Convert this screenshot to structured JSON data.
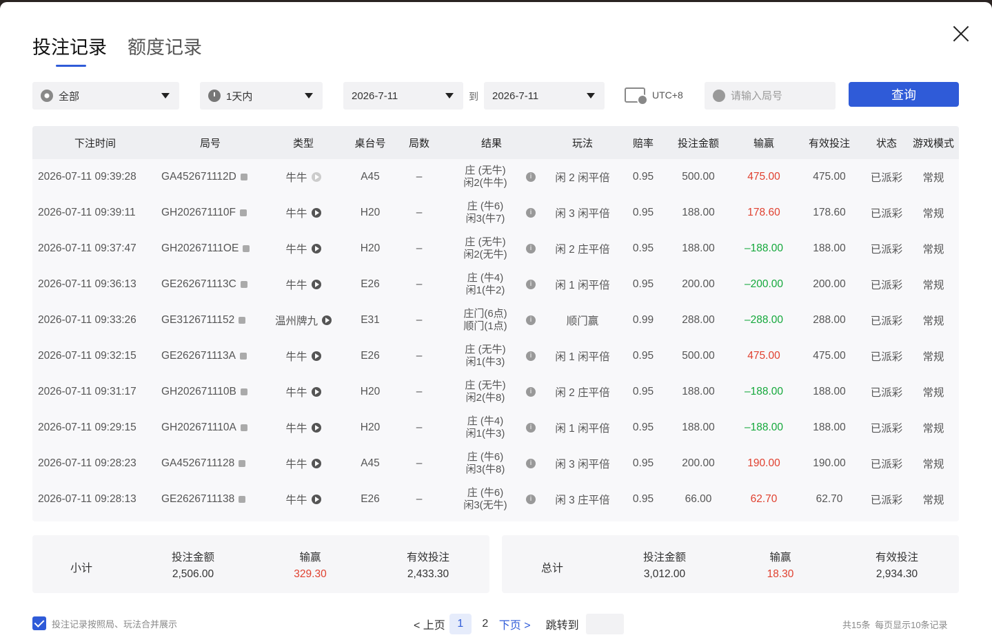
{
  "tabs": [
    {
      "label": "投注记录",
      "active": true
    },
    {
      "label": "额度记录",
      "active": false
    }
  ],
  "filters": {
    "game_type": "全部",
    "period": "1天内",
    "date_from": "2026-7-11",
    "to_label": "到",
    "date_to": "2026-7-11",
    "timezone": "UTC+8",
    "search_placeholder": "请输入局号",
    "query_button": "查询"
  },
  "table": {
    "headers": [
      "下注时间",
      "局号",
      "类型",
      "桌台号",
      "局数",
      "结果",
      "玩法",
      "赔率",
      "投注金额",
      "输赢",
      "有效投注",
      "状态",
      "游戏模式"
    ],
    "rows": [
      {
        "time": "2026-07-11 09:39:28",
        "id": "GA452671112D",
        "type": "牛牛",
        "table": "A45",
        "round": "–",
        "result1": "庄 (无牛)",
        "result2": "闲2(牛牛)",
        "play": "闲 2 闲平倍",
        "odds": "0.95",
        "bet": "500.00",
        "win": "475.00",
        "valid": "475.00",
        "status": "已派彩",
        "mode": "常规"
      },
      {
        "time": "2026-07-11 09:39:11",
        "id": "GH202671110F",
        "type": "牛牛",
        "table": "H20",
        "round": "–",
        "result1": "庄 (牛6)",
        "result2": "闲3(牛7)",
        "play": "闲 3 闲平倍",
        "odds": "0.95",
        "bet": "188.00",
        "win": "178.60",
        "valid": "178.60",
        "status": "已派彩",
        "mode": "常规"
      },
      {
        "time": "2026-07-11 09:37:47",
        "id": "GH20267111OE",
        "type": "牛牛",
        "table": "H20",
        "round": "–",
        "result1": "庄 (无牛)",
        "result2": "闲2(无牛)",
        "play": "闲 2 庄平倍",
        "odds": "0.95",
        "bet": "188.00",
        "win": "–188.00",
        "valid": "188.00",
        "status": "已派彩",
        "mode": "常规"
      },
      {
        "time": "2026-07-11 09:36:13",
        "id": "GE262671113C",
        "type": "牛牛",
        "table": "E26",
        "round": "–",
        "result1": "庄 (牛4)",
        "result2": "闲1(牛2)",
        "play": "闲 1 闲平倍",
        "odds": "0.95",
        "bet": "200.00",
        "win": "–200.00",
        "valid": "200.00",
        "status": "已派彩",
        "mode": "常规"
      },
      {
        "time": "2026-07-11 09:33:26",
        "id": "GE3126711152",
        "type": "温州牌九",
        "table": "E31",
        "round": "–",
        "result1": "庄门(6点)",
        "result2": "顺门(1点)",
        "play": "顺门赢",
        "odds": "0.99",
        "bet": "288.00",
        "win": "–288.00",
        "valid": "288.00",
        "status": "已派彩",
        "mode": "常规"
      },
      {
        "time": "2026-07-11 09:32:15",
        "id": "GE262671113A",
        "type": "牛牛",
        "table": "E26",
        "round": "–",
        "result1": "庄 (无牛)",
        "result2": "闲1(牛3)",
        "play": "闲 1 闲平倍",
        "odds": "0.95",
        "bet": "500.00",
        "win": "475.00",
        "valid": "475.00",
        "status": "已派彩",
        "mode": "常规"
      },
      {
        "time": "2026-07-11 09:31:17",
        "id": "GH202671110B",
        "type": "牛牛",
        "table": "H20",
        "round": "–",
        "result1": "庄 (无牛)",
        "result2": "闲2(牛8)",
        "play": "闲 2 庄平倍",
        "odds": "0.95",
        "bet": "188.00",
        "win": "–188.00",
        "valid": "188.00",
        "status": "已派彩",
        "mode": "常规"
      },
      {
        "time": "2026-07-11 09:29:15",
        "id": "GH202671110A",
        "type": "牛牛",
        "table": "H20",
        "round": "–",
        "result1": "庄 (牛4)",
        "result2": "闲1(牛3)",
        "play": "闲 1 闲平倍",
        "odds": "0.95",
        "bet": "188.00",
        "win": "–188.00",
        "valid": "188.00",
        "status": "已派彩",
        "mode": "常规"
      },
      {
        "time": "2026-07-11 09:28:23",
        "id": "GA4526711128",
        "type": "牛牛",
        "table": "A45",
        "round": "–",
        "result1": "庄 (牛6)",
        "result2": "闲3(牛8)",
        "play": "闲 3 闲平倍",
        "odds": "0.95",
        "bet": "200.00",
        "win": "190.00",
        "valid": "190.00",
        "status": "已派彩",
        "mode": "常规"
      },
      {
        "time": "2026-07-11 09:28:13",
        "id": "GE2626711138",
        "type": "牛牛",
        "table": "E26",
        "round": "–",
        "result1": "庄 (牛6)",
        "result2": "闲3(无牛)",
        "play": "闲 3 庄平倍",
        "odds": "0.95",
        "bet": "66.00",
        "win": "62.70",
        "valid": "62.70",
        "status": "已派彩",
        "mode": "常规"
      }
    ]
  },
  "subtotal": {
    "label": "小计",
    "bet_label": "投注金额",
    "bet": "2,506.00",
    "win_label": "输赢",
    "win": "329.30",
    "valid_label": "有效投注",
    "valid": "2,433.30"
  },
  "total": {
    "label": "总计",
    "bet_label": "投注金额",
    "bet": "3,012.00",
    "win_label": "输赢",
    "win": "18.30",
    "valid_label": "有效投注",
    "valid": "2,934.30"
  },
  "footer": {
    "merge_label": "投注记录按照局、玩法合并展示",
    "prev": "< 上页",
    "page1": "1",
    "page2": "2",
    "next": "下页 >",
    "jump_label": "跳转到",
    "total_info": "共15条",
    "per_page_info": "每页显示10条记录"
  },
  "colors": {
    "accent": "#2f5bd8",
    "positive": "#e0402f",
    "negative": "#14a83b"
  }
}
